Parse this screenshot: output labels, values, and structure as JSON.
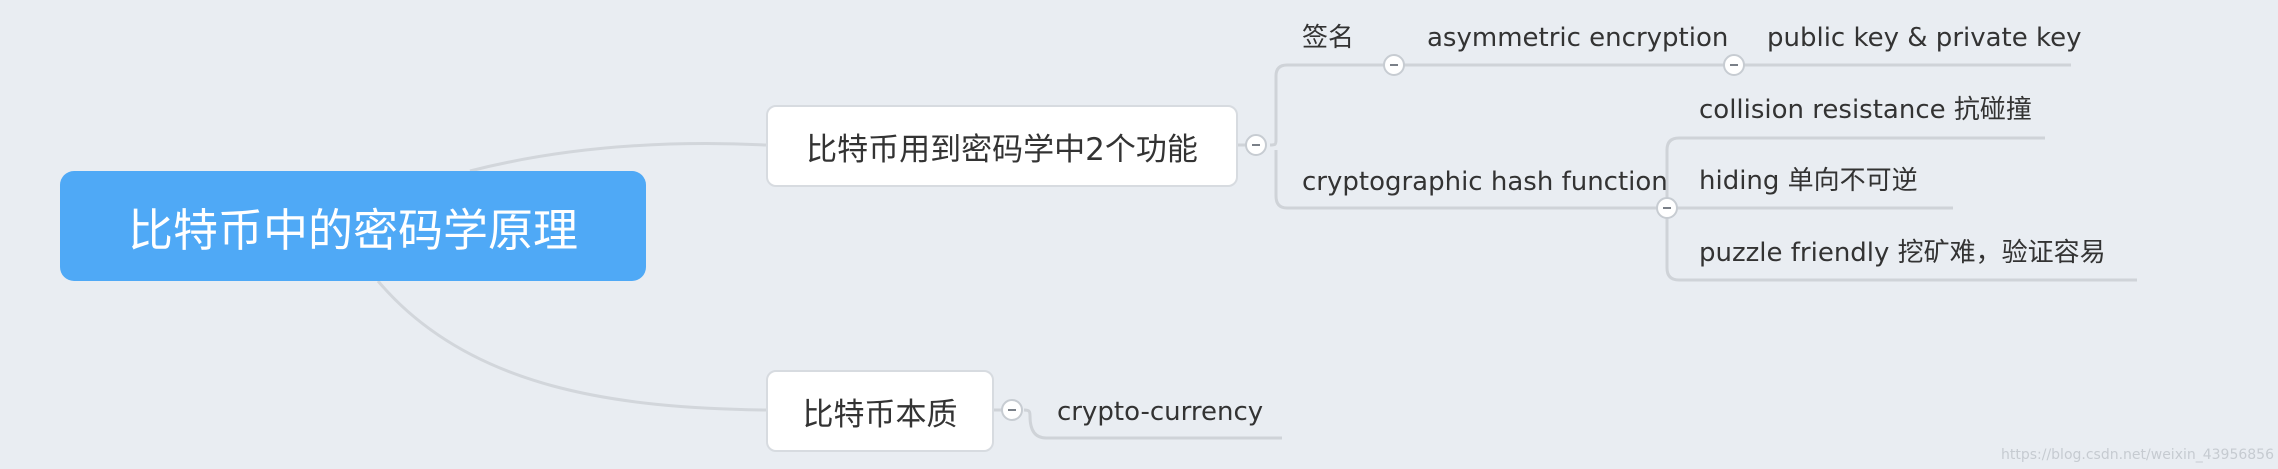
{
  "central_topic": "比特币中的密码学原理",
  "topics": [
    {
      "label": "比特币用到密码学中2个功能",
      "subtopics": [
        {
          "label": "签名",
          "child": "asymmetric encryption",
          "grandchild": "public key & private key"
        },
        {
          "label": "cryptographic hash function",
          "children": [
            "collision resistance 抗碰撞",
            "hiding 单向不可逆",
            "puzzle friendly 挖矿难，验证容易"
          ]
        }
      ]
    },
    {
      "label": "比特币本质",
      "child": "crypto-currency"
    }
  ],
  "watermark": "https://blog.csdn.net/weixin_43956856",
  "colors": {
    "background": "#e9edf2",
    "central_fill": "#4fa9f6",
    "branch_line": "#d2d6db",
    "leaf_line": "#cfd3d8",
    "text": "#333333"
  }
}
